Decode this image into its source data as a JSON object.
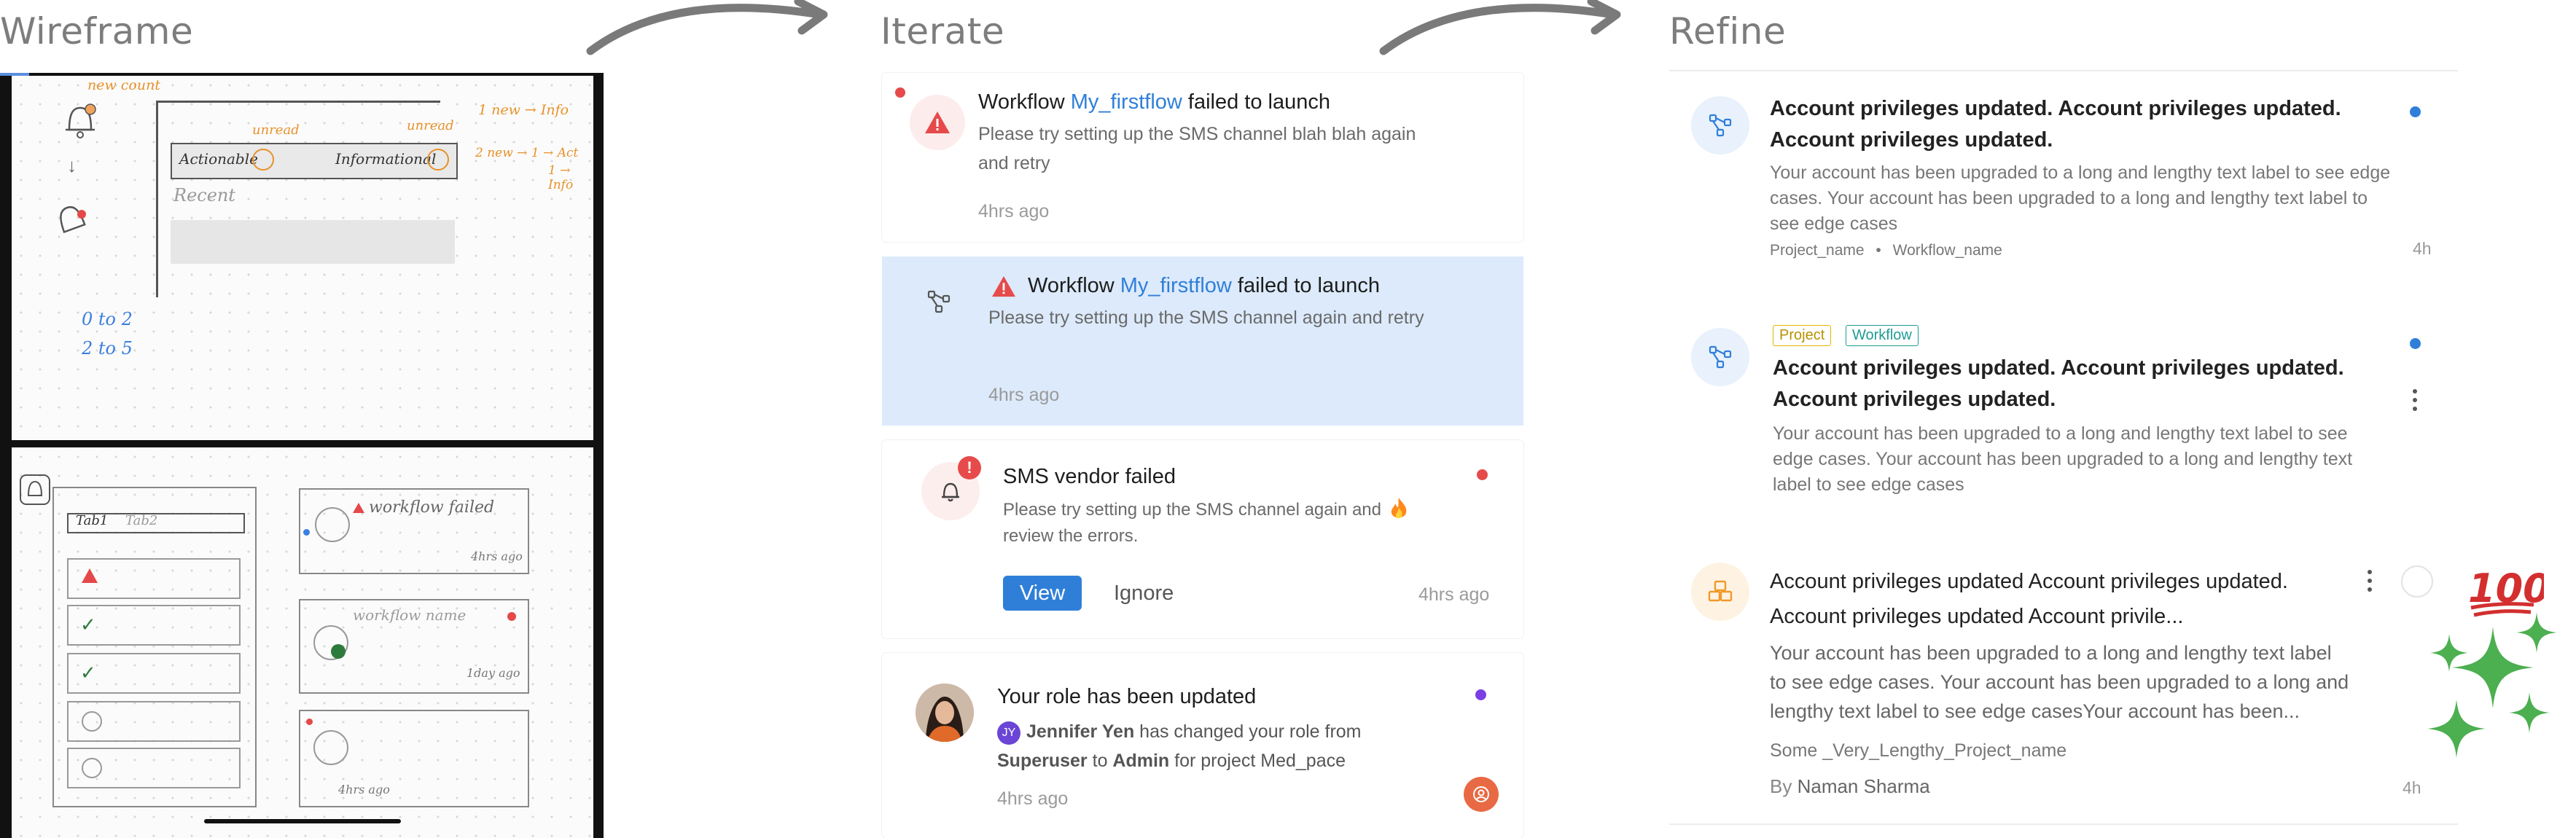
{
  "sections": {
    "wireframe_title": "Wireframe",
    "iterate_title": "Iterate",
    "refine_title": "Refine"
  },
  "wireframe": {
    "top": {
      "new_count": "new count",
      "unread_left": "unread",
      "unread_right": "unread",
      "tab_actionable": "Actionable",
      "tab_informational": "Informational",
      "recent": "Recent",
      "note_1": "1 new → Info",
      "note_2": "2 new → 1 → Act",
      "note_3": "1 → Info",
      "range_1": "0 to 2",
      "range_2": "2 to 5"
    },
    "bottom": {
      "tab_left": "Tab1",
      "tab_right": "Tab2",
      "workflow_failed": "workflow failed",
      "time_1": "4hrs ago",
      "workflow_name": "workflow name",
      "time_2": "1day ago",
      "time_3": "4hrs ago"
    }
  },
  "iterate": {
    "card1": {
      "title_pre": "Workflow ",
      "title_link": "My_firstflow",
      "title_post": " failed to launch",
      "body": "Please try setting up the SMS channel blah blah again and retry",
      "time": "4hrs ago"
    },
    "card2": {
      "title_pre": "Workflow ",
      "title_link": "My_firstflow",
      "title_post": " failed to launch",
      "body": "Please try setting up the SMS channel again and retry",
      "time": "4hrs ago"
    },
    "card3": {
      "title": "SMS vendor failed",
      "body": "Please try setting up the SMS channel again and review the errors.",
      "view_label": "View",
      "ignore_label": "Ignore",
      "time": "4hrs ago"
    },
    "card4": {
      "title": "Your role has been updated",
      "initials": "JY",
      "actor": "Jennifer Yen",
      "body_mid": " has changed your role from ",
      "from_role": "Superuser",
      "to_word": " to ",
      "to_role": "Admin",
      "body_end": " for project Med_pace",
      "time": "4hrs ago"
    }
  },
  "refine": {
    "card1": {
      "title": "Account privileges updated. Account privileges updated. Account privileges updated.",
      "body": "Your account has been upgraded to a long and lengthy text label to see edge cases. Your account has been upgraded to a long and lengthy text label to see edge cases",
      "project": "Project_name",
      "separator": "•",
      "workflow": "Workflow_name",
      "time": "4h"
    },
    "card2": {
      "tag_project": "Project",
      "tag_workflow": "Workflow",
      "title": "Account privileges updated. Account privileges updated. Account privileges updated.",
      "body": "Your account has been upgraded to a long and lengthy text label to see edge cases. Your account has been upgraded to a long and lengthy text label to see edge cases"
    },
    "card3": {
      "title": "Account privileges updated Account privileges updated. Account privileges updated Account privile...",
      "body": "Your account has been upgraded to a long and lengthy text label to see edge cases. Your account has been upgraded to a long and lengthy text label to see edge casesYour account has been...",
      "project": "Some _Very_Lengthy_Project_name",
      "by_prefix": "By ",
      "author": "Naman Sharma",
      "time": "4h"
    }
  },
  "colors": {
    "accent_blue": "#2f7fd9",
    "highlight_bg": "#dceafb",
    "danger_red": "#e64a4a",
    "unread_purple": "#7b3fe4",
    "tag_yellow": "#e3b400",
    "tag_teal": "#1f9c94",
    "sparkle_green": "#4caf50",
    "emoji_red": "#d32f2f"
  },
  "icons": {
    "arrow_1": "curved-arrow-icon",
    "arrow_2": "curved-arrow-icon",
    "alert": "warning-triangle-icon",
    "workflow": "workflow-nodes-icon",
    "bell": "bell-icon",
    "hundred": "hundred-points-emoji",
    "sparkles": "sparkles-icon",
    "fire": "fire-emoji"
  }
}
